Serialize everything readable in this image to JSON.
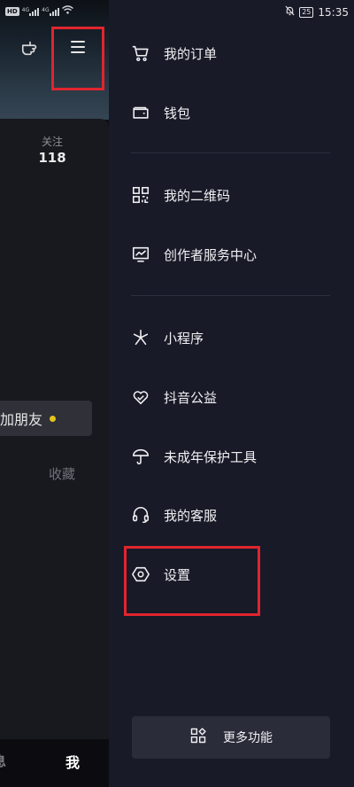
{
  "status_bar": {
    "left_badge": "HD",
    "signal_1_tag": "4G",
    "signal_2_tag": "4G",
    "battery": "25",
    "time": "15:35"
  },
  "profile": {
    "follow_label": "关注",
    "follow_count": "118",
    "add_friend_label": "加朋友",
    "favorites_tab": "收藏",
    "bottom_nav_messages": "息",
    "bottom_nav_me": "我"
  },
  "drawer": {
    "items": [
      {
        "label": "我的订单",
        "icon": "cart-icon"
      },
      {
        "label": "钱包",
        "icon": "wallet-icon"
      },
      {
        "label": "我的二维码",
        "icon": "qrcode-icon"
      },
      {
        "label": "创作者服务中心",
        "icon": "chart-monitor-icon"
      },
      {
        "label": "小程序",
        "icon": "mini-program-icon"
      },
      {
        "label": "抖音公益",
        "icon": "heart-icon"
      },
      {
        "label": "未成年保护工具",
        "icon": "umbrella-icon"
      },
      {
        "label": "我的客服",
        "icon": "headset-icon"
      },
      {
        "label": "设置",
        "icon": "gear-hexagon-icon"
      }
    ],
    "more_features_label": "更多功能"
  },
  "colors": {
    "drawer_bg": "#181a28",
    "highlight_red": "#e0252e",
    "accent_yellow": "#e2c51b"
  }
}
